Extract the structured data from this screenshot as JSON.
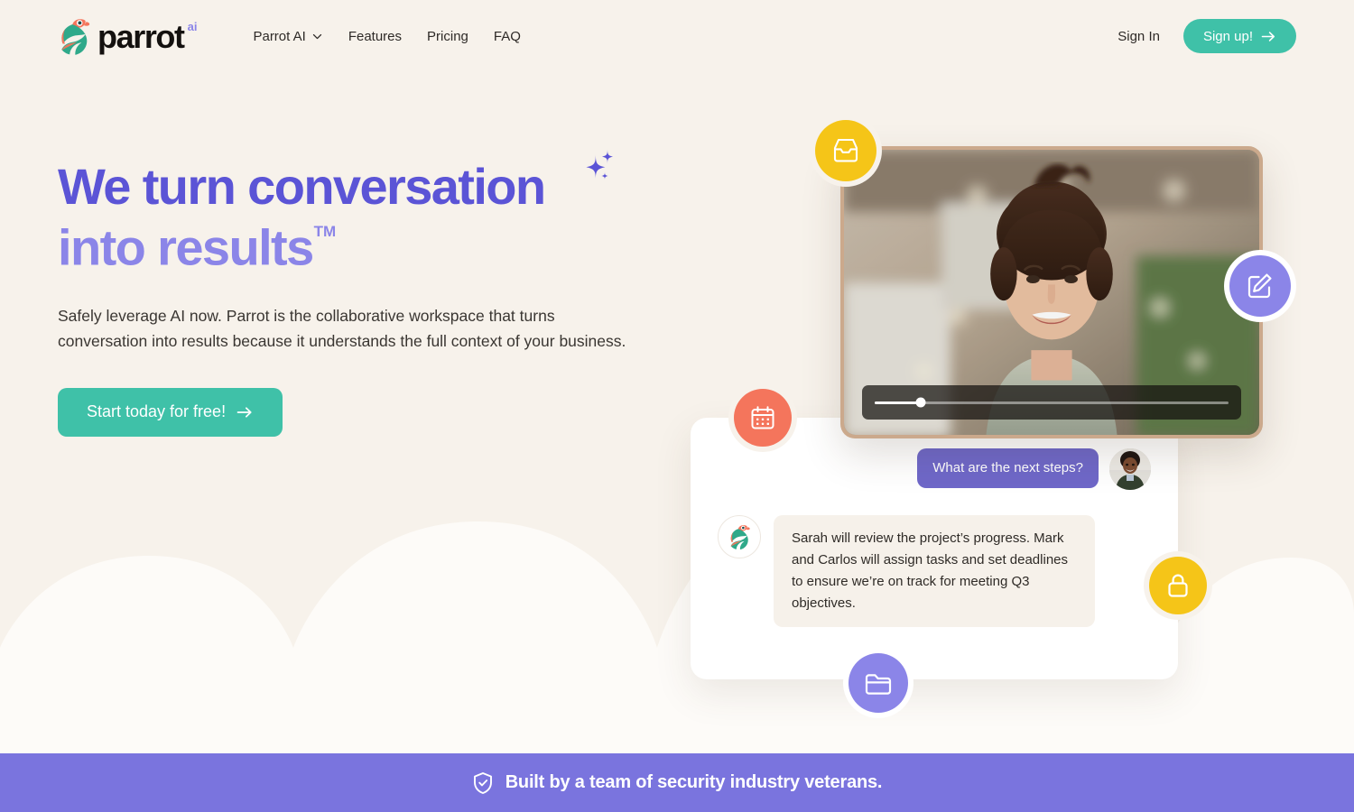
{
  "brand": {
    "name": "parrot",
    "superscript": "ai",
    "logo_icon": "parrot-logo-icon",
    "accent_teal": "#3FC1A8",
    "accent_purple": "#5B54D6",
    "accent_purple_light": "#8B85E8",
    "accent_yellow": "#F5C518",
    "accent_coral": "#F4755C",
    "background": "#F7F2EB"
  },
  "header": {
    "nav": [
      {
        "label": "Parrot AI",
        "icon": "chevron-down-icon",
        "has_dropdown": true
      },
      {
        "label": "Features",
        "has_dropdown": false
      },
      {
        "label": "Pricing",
        "has_dropdown": false
      },
      {
        "label": "FAQ",
        "has_dropdown": false
      }
    ],
    "sign_in": "Sign In",
    "sign_up": "Sign up!",
    "sign_up_icon": "arrow-right-icon"
  },
  "hero": {
    "headline_line1": "We turn conversation",
    "headline_line2": "into results",
    "trademark": "TM",
    "sparkle_icon": "sparkles-icon",
    "subcopy": "Safely leverage AI now. Parrot is the collaborative workspace that turns conversation into results because it understands the full context of your business.",
    "cta_label": "Start today for free!",
    "cta_icon": "arrow-right-icon"
  },
  "video": {
    "alt": "Smiling woman on a video call in a cafe",
    "progress_percent": 13,
    "scrubber_label": "video-progress"
  },
  "chat": {
    "user_message": "What are the next steps?",
    "user_avatar": "user-avatar",
    "bot_avatar_icon": "parrot-avatar-icon",
    "bot_message": "Sarah will review the project’s progress. Mark and Carlos will assign tasks and set deadlines to ensure we’re on track for meeting Q3 objectives."
  },
  "badges": [
    {
      "name": "inbox-badge",
      "icon": "inbox-icon",
      "color": "#F5C518"
    },
    {
      "name": "edit-badge",
      "icon": "edit-icon",
      "color": "#8B85E8"
    },
    {
      "name": "calendar-badge",
      "icon": "calendar-icon",
      "color": "#F4755C"
    },
    {
      "name": "lock-badge",
      "icon": "lock-icon",
      "color": "#F5C518"
    },
    {
      "name": "folder-badge",
      "icon": "folder-icon",
      "color": "#8B85E8"
    }
  ],
  "banner": {
    "icon": "shield-check-icon",
    "text": "Built by a team of security industry veterans.",
    "background": "#7A74DE"
  }
}
